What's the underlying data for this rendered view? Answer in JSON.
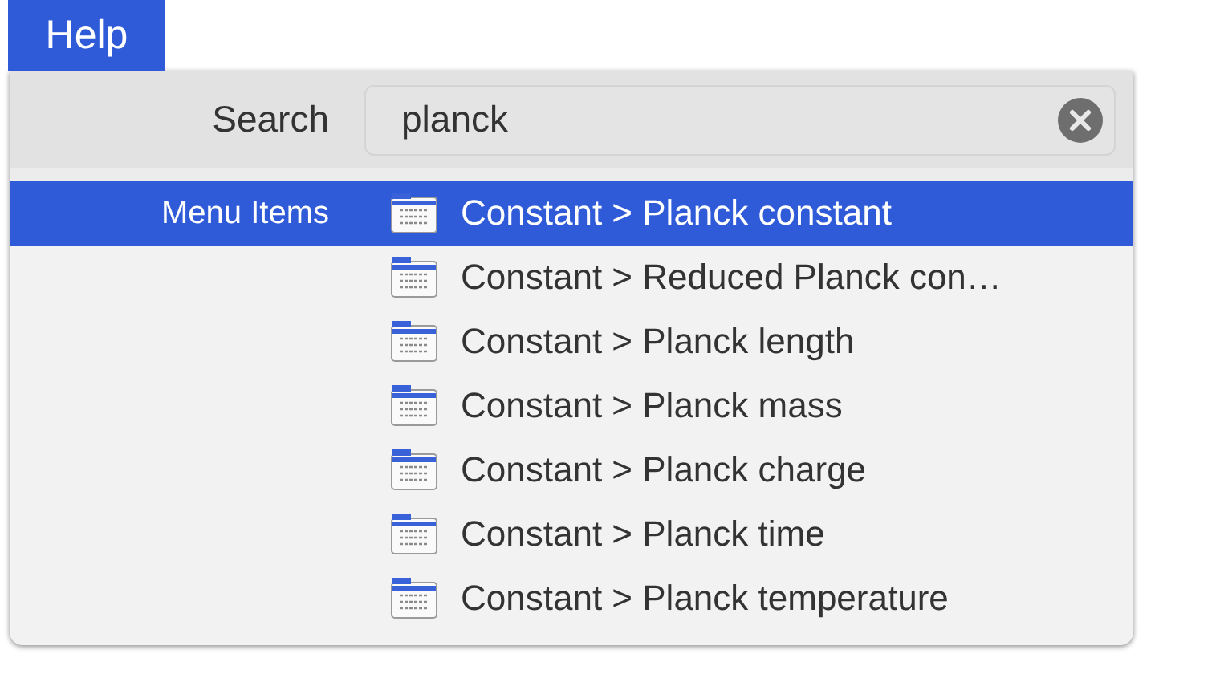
{
  "menu_title": "Help",
  "search": {
    "label": "Search",
    "value": "planck"
  },
  "results": {
    "section_label": "Menu Items",
    "items": [
      {
        "label": "Constant > Planck constant",
        "selected": true
      },
      {
        "label": "Constant > Reduced Planck con…",
        "selected": false
      },
      {
        "label": "Constant > Planck length",
        "selected": false
      },
      {
        "label": "Constant > Planck mass",
        "selected": false
      },
      {
        "label": "Constant > Planck charge",
        "selected": false
      },
      {
        "label": "Constant > Planck time",
        "selected": false
      },
      {
        "label": "Constant > Planck temperature",
        "selected": false
      }
    ]
  }
}
